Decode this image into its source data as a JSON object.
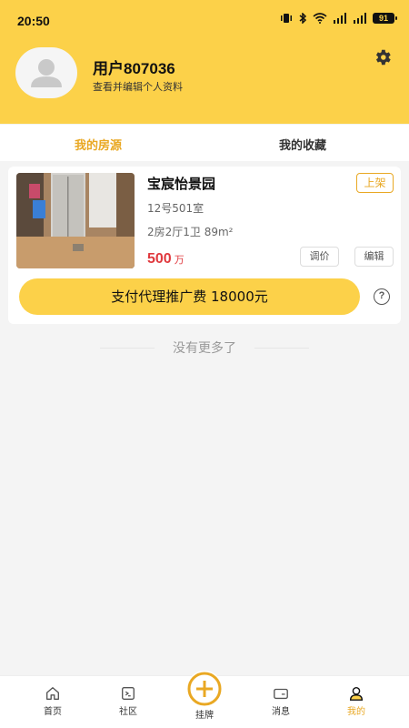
{
  "status_bar": {
    "time": "20:50",
    "battery": "91"
  },
  "profile": {
    "username": "用户807036",
    "subtitle": "查看并编辑个人资料"
  },
  "tabs": [
    {
      "label": "我的房源",
      "active": true
    },
    {
      "label": "我的收藏",
      "active": false
    }
  ],
  "listing": {
    "title": "宝宸怡景园",
    "status_badge": "上架",
    "room": "12号501室",
    "layout": "2房2厅1卫 89m²",
    "price_value": "500",
    "price_unit": "万",
    "adjust_price_label": "调价",
    "edit_label": "编辑",
    "pay_label": "支付代理推广费 18000元",
    "help_glyph": "?"
  },
  "list_end_text": "没有更多了",
  "bottom_nav": [
    {
      "label": "首页",
      "icon": "home-icon",
      "active": false
    },
    {
      "label": "社区",
      "icon": "community-icon",
      "active": false
    },
    {
      "label": "挂牌",
      "icon": "plus-circle-icon",
      "active": false
    },
    {
      "label": "消息",
      "icon": "message-icon",
      "active": false
    },
    {
      "label": "我的",
      "icon": "person-icon",
      "active": true
    }
  ],
  "colors": {
    "brand_yellow": "#fcd149",
    "accent_orange": "#e9a823",
    "price_red": "#e0393e"
  }
}
